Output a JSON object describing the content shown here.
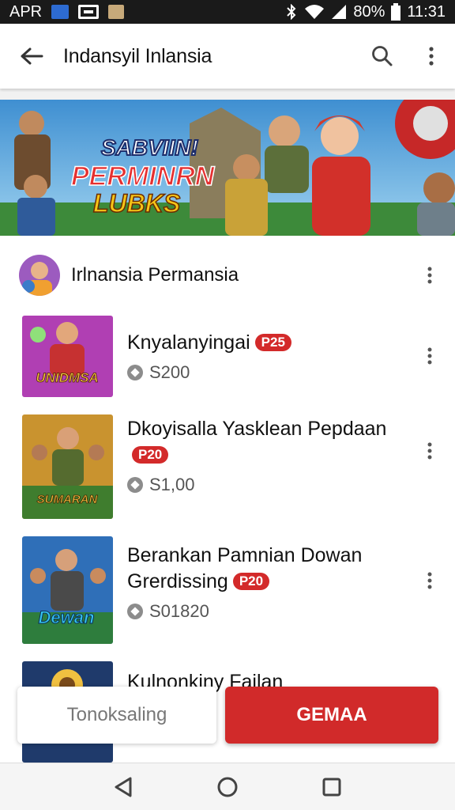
{
  "status_bar": {
    "carrier": "APR",
    "battery": "80%",
    "time": "11:31"
  },
  "app_bar": {
    "title": "Indansyil Inlansia",
    "icons": [
      "back-arrow-icon",
      "search-icon",
      "more-vert-icon"
    ]
  },
  "banner": {
    "line1": "SABVIIN!",
    "line2": "PERMINRN",
    "line3": "LUBKS"
  },
  "developer": {
    "name": "Irlnansia Permansia"
  },
  "apps": [
    {
      "title": "Knyalanyingai",
      "badge": "P25",
      "price": "S200",
      "thumb_text": "UNIDMSA"
    },
    {
      "title": "Dkoyisalla Yasklean Pepdaan",
      "badge": "P20",
      "price": "S1,00",
      "thumb_text": "SUMARAN"
    },
    {
      "title": "Berankan Pamnian Dowan Grerdissing",
      "badge": "P20",
      "price": "S01820",
      "thumb_text": "Dewan"
    },
    {
      "title": "Kulnonkiny Failan"
    }
  ],
  "buttons": {
    "secondary": "Tonoksaling",
    "primary": "GEMAA"
  },
  "colors": {
    "accent": "#d12a2a",
    "status_bar": "#1a1a1a",
    "background": "#ffffff"
  }
}
